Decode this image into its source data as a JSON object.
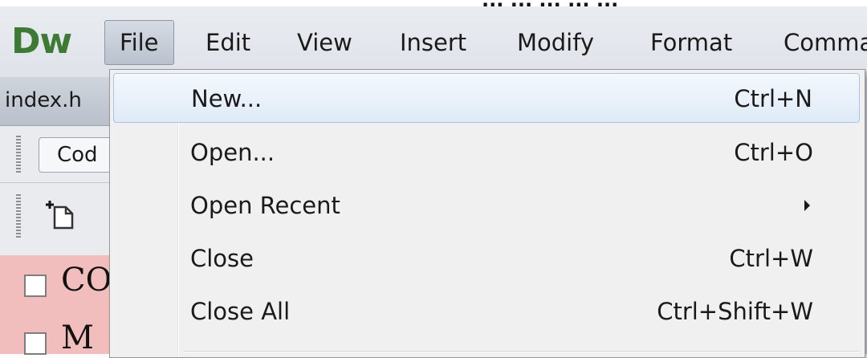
{
  "top_text": "... ... ... ... ...",
  "app": {
    "logo": "Dw"
  },
  "menubar": {
    "items": [
      {
        "label": "File"
      },
      {
        "label": "Edit"
      },
      {
        "label": "View"
      },
      {
        "label": "Insert"
      },
      {
        "label": "Modify"
      },
      {
        "label": "Format"
      },
      {
        "label": "Comma"
      }
    ]
  },
  "document": {
    "tab_label": "index.h"
  },
  "toolbar": {
    "code_label": "Cod"
  },
  "content": {
    "line1": "CO",
    "line2": "M"
  },
  "file_menu": {
    "items": [
      {
        "label": "New...",
        "shortcut": "Ctrl+N"
      },
      {
        "label": "Open...",
        "shortcut": "Ctrl+O"
      },
      {
        "label": "Open Recent",
        "shortcut": ""
      },
      {
        "label": "Close",
        "shortcut": "Ctrl+W"
      },
      {
        "label": "Close All",
        "shortcut": "Ctrl+Shift+W"
      }
    ]
  },
  "colors": {
    "logo_green": "#3d7b34",
    "menu_background": "#f0f0f0",
    "hover_border": "#a9c4e6",
    "content_pink": "#f2bdbd"
  }
}
